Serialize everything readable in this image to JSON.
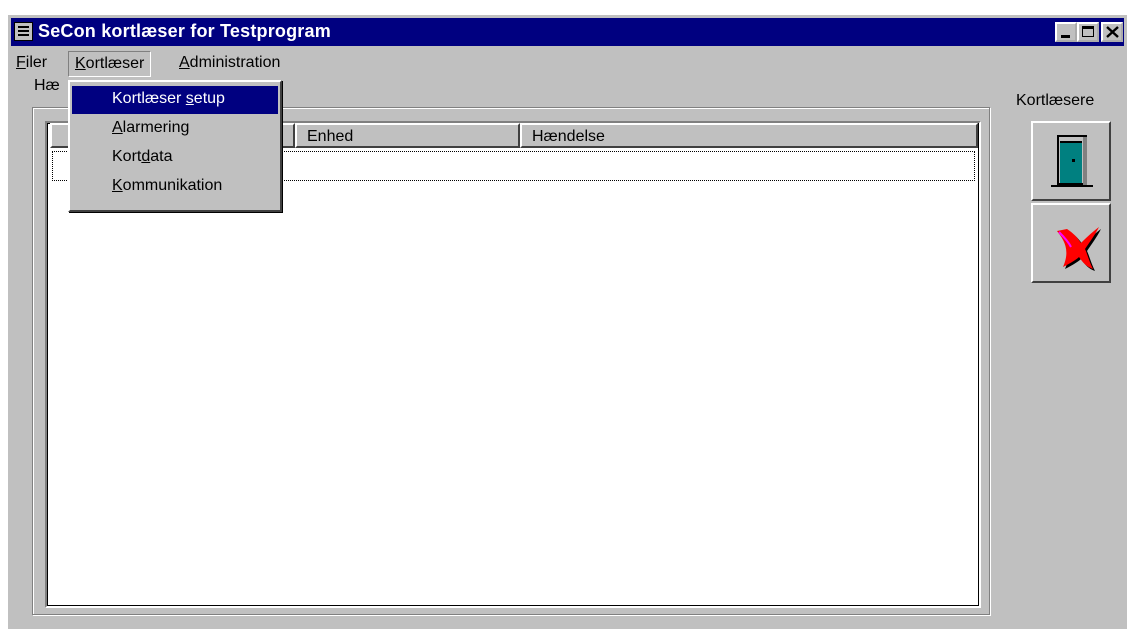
{
  "window": {
    "title": "SeCon kortlæser for Testprogram",
    "controls": [
      "minimize-icon",
      "maximize-icon",
      "close-icon"
    ]
  },
  "menubar": {
    "items": [
      {
        "label_pre": "",
        "accel": "F",
        "label_post": "iler"
      },
      {
        "label_pre": "",
        "accel": "K",
        "label_post": "ortlæser"
      },
      {
        "label_pre": "",
        "accel": "A",
        "label_post": "dministration"
      }
    ]
  },
  "kortlaeser_menu": {
    "items": [
      {
        "label_pre": "Kortlæser ",
        "accel": "s",
        "label_post": "etup",
        "highlighted": true
      },
      {
        "label_pre": "",
        "accel": "A",
        "label_post": "larmering",
        "highlighted": false
      },
      {
        "label_pre": "Kort",
        "accel": "d",
        "label_post": "ata",
        "highlighted": false
      },
      {
        "label_pre": "",
        "accel": "K",
        "label_post": "ommunikation",
        "highlighted": false
      }
    ]
  },
  "main": {
    "group_label_visible": "Hæ",
    "columns": [
      "",
      "",
      "Enhed",
      "Hændelse"
    ],
    "rows": []
  },
  "sidebar": {
    "label": "Kortlæsere",
    "buttons": [
      {
        "icon": "door-icon"
      },
      {
        "icon": "red-x-icon"
      }
    ]
  },
  "colors": {
    "titlebar": "#000080",
    "face": "#c0c0c0",
    "highlight": "#000080"
  }
}
